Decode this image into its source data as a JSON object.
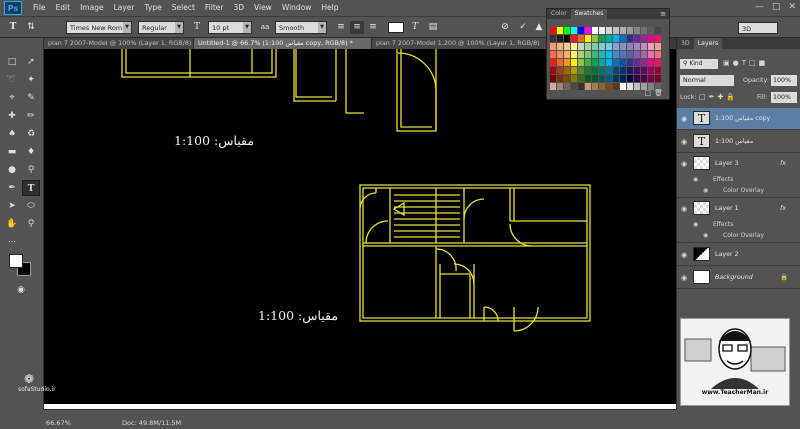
{
  "app": {
    "logo": "Ps",
    "menu": [
      "File",
      "Edit",
      "Image",
      "Layer",
      "Type",
      "Select",
      "Filter",
      "3D",
      "View",
      "Window",
      "Help"
    ]
  },
  "options_bar": {
    "font_family": "Times New Rom...",
    "font_style": "Regular",
    "font_size": "10 pt",
    "antialias": "Smooth",
    "workspace": "3D"
  },
  "tabs": [
    {
      "label": "plan 7 2007-Model @ 100% (Layer 1, RGB/8)",
      "active": false
    },
    {
      "label": "Untitled-1 @ 66.7% (1:100 مقیاس copy, RGB/8) *",
      "active": true
    },
    {
      "label": "plan 7 2007-Model 1.200 @ 100% (Layer 1, RGB/8)",
      "active": false
    }
  ],
  "canvas": {
    "scale_label_1": "مقیاس: 1:100",
    "scale_label_2": "مقیاس: 1:100"
  },
  "swatches_panel": {
    "tabs": [
      "Color",
      "Swatches"
    ],
    "active_tab": "Swatches"
  },
  "layers_panel": {
    "tabs": [
      "3D",
      "Layers"
    ],
    "active_tab": "Layers",
    "kind_label": "Kind",
    "blend_mode": "Normal",
    "opacity_label": "Opacity:",
    "opacity_value": "100%",
    "lock_label": "Lock:",
    "fill_label": "Fill:",
    "fill_value": "100%",
    "layers": [
      {
        "name": "1:100 مقیاس copy",
        "type": "text",
        "selected": true
      },
      {
        "name": "1:100 مقیاس",
        "type": "text",
        "selected": false
      },
      {
        "name": "Layer 3",
        "type": "raster",
        "fx": "fx",
        "effects_label": "Effects",
        "effect": "Color Overlay"
      },
      {
        "name": "Layer 1",
        "type": "raster",
        "fx": "fx",
        "effects_label": "Effects",
        "effect": "Color Overlay"
      },
      {
        "name": "Layer 2",
        "type": "raster"
      },
      {
        "name": "Background",
        "type": "background"
      }
    ]
  },
  "status": {
    "zoom": "66.67%",
    "doc": "Doc: 49.8M/11.5M"
  },
  "watermarks": {
    "left": "sofaStudio.ir",
    "right": "www.TeacherMan.ir"
  },
  "colors": {
    "ui_bg": "#535353",
    "canvas_bg": "#000000",
    "plan_line": "#e8e03a",
    "selected_layer": "#5b7ea5"
  }
}
